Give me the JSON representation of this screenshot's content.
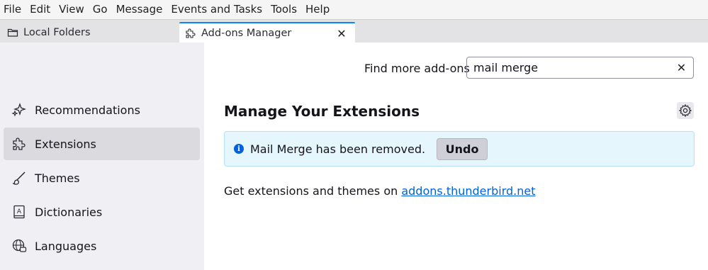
{
  "menubar": {
    "items": [
      "File",
      "Edit",
      "View",
      "Go",
      "Message",
      "Events and Tasks",
      "Tools",
      "Help"
    ]
  },
  "tabs": [
    {
      "label": "Local Folders",
      "icon": "folder-icon"
    },
    {
      "label": "Add-ons Manager",
      "icon": "puzzle-icon"
    }
  ],
  "sidebar": {
    "items": [
      {
        "label": "Recommendations",
        "icon": "sparkle-icon"
      },
      {
        "label": "Extensions",
        "icon": "puzzle-icon"
      },
      {
        "label": "Themes",
        "icon": "brush-icon"
      },
      {
        "label": "Dictionaries",
        "icon": "dictionary-icon"
      },
      {
        "label": "Languages",
        "icon": "globe-icon"
      }
    ],
    "selected": "Extensions"
  },
  "main": {
    "find_label": "Find more add-ons",
    "search_value": "mail merge",
    "heading": "Manage Your Extensions",
    "notice": {
      "message": "Mail Merge has been removed.",
      "undo_label": "Undo"
    },
    "get_text": "Get extensions and themes on ",
    "link_text": "addons.thunderbird.net"
  },
  "colors": {
    "accent": "#0060df",
    "notice_bg": "#e6f6fd",
    "selected_bg": "#dbdbdf"
  }
}
